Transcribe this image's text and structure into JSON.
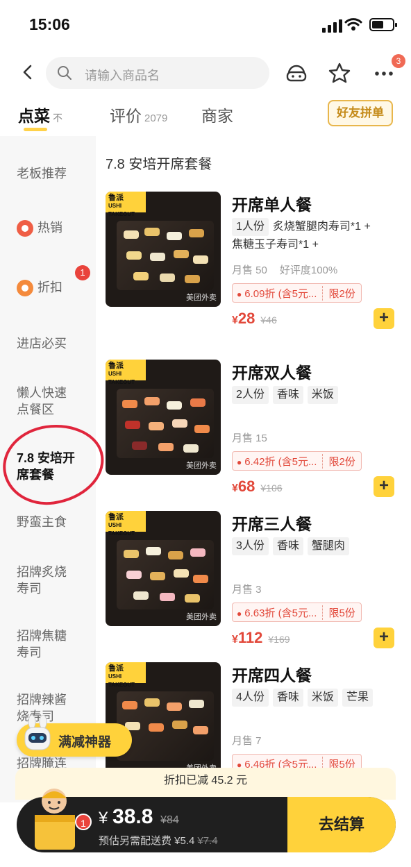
{
  "status_bar": {
    "time": "15:06"
  },
  "nav": {
    "search_placeholder": "请输入商品名",
    "more_badge": "3"
  },
  "tabs": [
    {
      "label": "点菜",
      "sub": "不"
    },
    {
      "label": "评价",
      "count": "2079"
    },
    {
      "label": "商家"
    }
  ],
  "friend_button": "好友拼单",
  "sidebar": {
    "items": [
      {
        "label": "老板推荐"
      },
      {
        "label": "热销",
        "icon": "flame-icon"
      },
      {
        "label": "折扣",
        "icon": "discount-icon",
        "badge": "1"
      },
      {
        "label": "进店必买"
      },
      {
        "label_line1": "懒人快速",
        "label_line2": "点餐区"
      },
      {
        "label_line1": "7.8 安培开",
        "label_line2": "席套餐"
      },
      {
        "label": "野蛮主食"
      },
      {
        "label_line1": "招牌炙烧",
        "label_line2": "寿司"
      },
      {
        "label_line1": "招牌焦糖",
        "label_line2": "寿司"
      },
      {
        "label_line1": "招牌辣酱",
        "label_line2": "烧寿司"
      },
      {
        "label": "招牌腌连"
      }
    ]
  },
  "section_title": "7.8 安培开席套餐",
  "items": [
    {
      "name": "开席单人餐",
      "tags": [
        "1人份",
        "炙烧蟹腿肉寿司*1 +",
        "焦糖玉子寿司*1 +"
      ],
      "sold": "月售 50",
      "rating": "好评度100%",
      "promo": "6.09折 (含5元...",
      "limit": "限2份",
      "price": "28",
      "old_price": "¥46"
    },
    {
      "name": "开席双人餐",
      "tags": [
        "2人份",
        "香味",
        "米饭"
      ],
      "sold": "月售 15",
      "rating": "",
      "promo": "6.42折 (含5元...",
      "limit": "限2份",
      "price": "68",
      "old_price": "¥106"
    },
    {
      "name": "开席三人餐",
      "tags": [
        "3人份",
        "香味",
        "蟹腿肉"
      ],
      "sold": "月售 3",
      "rating": "",
      "promo": "6.63折 (含5元...",
      "limit": "限5份",
      "price": "112",
      "old_price": "¥169"
    },
    {
      "name": "开席四人餐",
      "tags": [
        "4人份",
        "香味",
        "米饭",
        "芒果"
      ],
      "sold": "月售 7",
      "rating": "",
      "promo": "6.46折 (含5元...",
      "limit": "限5份",
      "price": "",
      "old_price": ""
    }
  ],
  "thumb": {
    "logo_line1": "鲁派",
    "logo_line2": "USHI TAKEOUT",
    "watermark": "美团外卖"
  },
  "currency": "¥",
  "add_symbol": "+",
  "helper_label": "满减神器",
  "discount_notice": "折扣已减 45.2 元",
  "cart": {
    "badge": "1",
    "total_prefix": "¥",
    "total": "38.8",
    "old_total": "¥84",
    "fee_text": "预估另需配送费 ¥5.4",
    "old_fee": "¥7.4",
    "checkout": "去结算"
  }
}
